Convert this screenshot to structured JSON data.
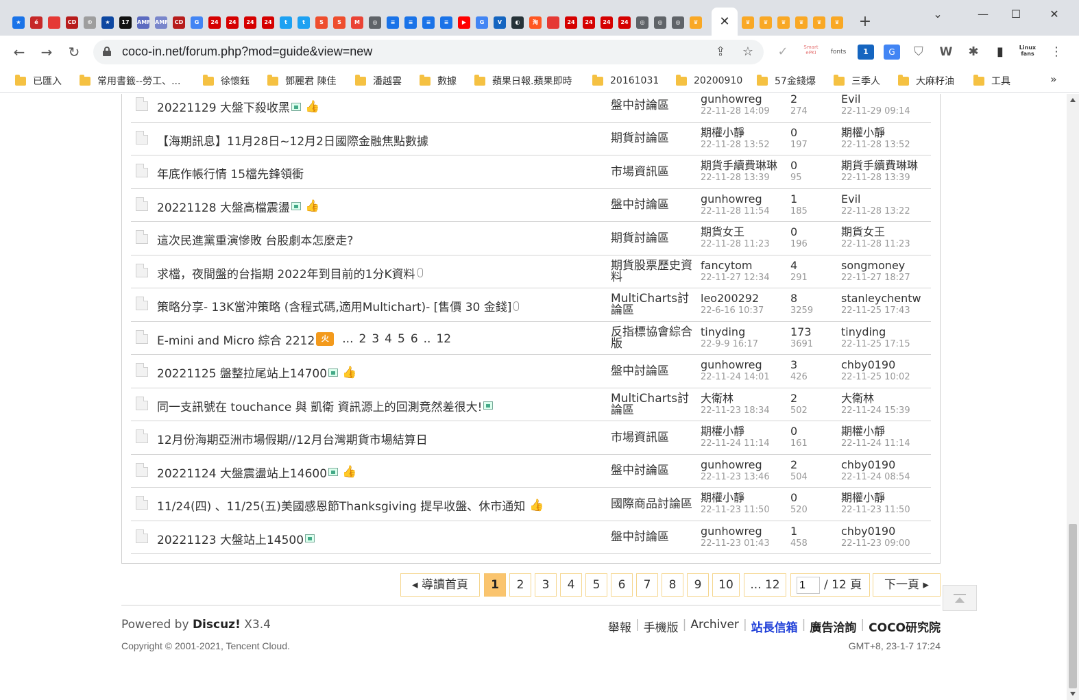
{
  "browser": {
    "url": "coco-in.net/forum.php?mod=guide&view=new",
    "tab_favicons_left": [
      {
        "icon": "star-icon",
        "color": "#1a73e8",
        "text": "★"
      },
      {
        "icon": "red-logo-icon",
        "color": "#c62828",
        "text": "é"
      },
      {
        "icon": "stripes-icon",
        "color": "#e53935",
        "text": ""
      },
      {
        "icon": "cd-icon",
        "color": "#b71c1c",
        "text": "CD"
      },
      {
        "icon": "coin-icon",
        "color": "#9e9e9e",
        "text": "©"
      },
      {
        "icon": "star-box-icon",
        "color": "#0d47a1",
        "text": "★"
      },
      {
        "icon": "17-icon",
        "color": "#111111",
        "text": "17"
      },
      {
        "icon": "amf-icon",
        "color": "#5c6bc0",
        "text": "AMF"
      },
      {
        "icon": "amf-icon",
        "color": "#7986cb",
        "text": "AMF"
      },
      {
        "icon": "cd-icon",
        "color": "#b71c1c",
        "text": "CD"
      },
      {
        "icon": "google-icon",
        "color": "#4285f4",
        "text": "G"
      },
      {
        "icon": "24-icon",
        "color": "#d50000",
        "text": "24"
      },
      {
        "icon": "24-icon",
        "color": "#d50000",
        "text": "24"
      },
      {
        "icon": "24-icon",
        "color": "#d50000",
        "text": "24"
      },
      {
        "icon": "24-icon",
        "color": "#d50000",
        "text": "24"
      },
      {
        "icon": "twitter-icon",
        "color": "#1da1f2",
        "text": "t"
      },
      {
        "icon": "twitter-icon",
        "color": "#1da1f2",
        "text": "t"
      },
      {
        "icon": "shopee-icon",
        "color": "#ee4d2d",
        "text": "S"
      },
      {
        "icon": "shopee-icon",
        "color": "#ee4d2d",
        "text": "S"
      },
      {
        "icon": "gmail-icon",
        "color": "#ea4335",
        "text": "M"
      },
      {
        "icon": "globe-icon",
        "color": "#5f6368",
        "text": "◎"
      },
      {
        "icon": "doc-icon",
        "color": "#1a73e8",
        "text": "≡"
      },
      {
        "icon": "doc-icon",
        "color": "#1a73e8",
        "text": "≡"
      },
      {
        "icon": "doc-icon",
        "color": "#1a73e8",
        "text": "≡"
      },
      {
        "icon": "doc-icon",
        "color": "#1a73e8",
        "text": "≡"
      },
      {
        "icon": "youtube-icon",
        "color": "#ff0000",
        "text": "▶"
      },
      {
        "icon": "translate-icon",
        "color": "#4285f4",
        "text": "G"
      },
      {
        "icon": "v-icon",
        "color": "#1565c0",
        "text": "V"
      },
      {
        "icon": "dark-icon",
        "color": "#263238",
        "text": "◐"
      },
      {
        "icon": "taobao-icon",
        "color": "#ff5722",
        "text": "淘"
      },
      {
        "icon": "stripes-icon",
        "color": "#e53935",
        "text": ""
      },
      {
        "icon": "24-icon",
        "color": "#d50000",
        "text": "24"
      },
      {
        "icon": "24-icon",
        "color": "#d50000",
        "text": "24"
      },
      {
        "icon": "24-icon",
        "color": "#d50000",
        "text": "24"
      },
      {
        "icon": "24-icon",
        "color": "#d50000",
        "text": "24"
      },
      {
        "icon": "globe-icon",
        "color": "#5f6368",
        "text": "◎"
      },
      {
        "icon": "globe-icon",
        "color": "#5f6368",
        "text": "◎"
      },
      {
        "icon": "globe-icon",
        "color": "#5f6368",
        "text": "◎"
      },
      {
        "icon": "trophy-icon",
        "color": "#f9a825",
        "text": "♛"
      }
    ],
    "tab_favicons_right": [
      {
        "icon": "trophy-icon",
        "color": "#f9a825",
        "text": "♛"
      },
      {
        "icon": "trophy-icon",
        "color": "#f9a825",
        "text": "♛"
      },
      {
        "icon": "trophy-icon",
        "color": "#f9a825",
        "text": "♛"
      },
      {
        "icon": "trophy-icon",
        "color": "#f9a825",
        "text": "♛"
      },
      {
        "icon": "trophy-icon",
        "color": "#f9a825",
        "text": "♛"
      },
      {
        "icon": "trophy-icon",
        "color": "#f9a825",
        "text": "♛"
      }
    ],
    "extensions": {
      "smart_label": "Smart\nePKI",
      "fonts_label": "fonts",
      "badge_count": "1",
      "linux_label": "Linux\nfans"
    },
    "bookmarks": [
      "已匯入",
      "常用書籤--勞工、...",
      "徐懷鈺",
      "鄧麗君 陳佳",
      "潘越雲",
      "數據",
      "蘋果日報.蘋果即時",
      "20161031",
      "20200910",
      "57金錢爆",
      "三季人",
      "大麻籽油",
      "工具"
    ]
  },
  "threads": [
    {
      "title": "20221129 大盤下殺收黑",
      "img": true,
      "thumb": true,
      "clip": false,
      "hot": false,
      "pages": [],
      "forum": "盤中討論區",
      "author": "gunhowreg",
      "author_date": "22-11-28 14:09",
      "replies": "2",
      "views": "274",
      "last_user": "Evil",
      "last_date": "22-11-29 09:14"
    },
    {
      "title": "【海期訊息】11月28日~12月2日國際金融焦點數據",
      "img": false,
      "thumb": false,
      "clip": false,
      "hot": false,
      "pages": [],
      "forum": "期貨討論區",
      "author": "期權小靜",
      "author_date": "22-11-28 13:52",
      "replies": "0",
      "views": "197",
      "last_user": "期權小靜",
      "last_date": "22-11-28 13:52"
    },
    {
      "title": "年底作帳行情 15檔先鋒領衝",
      "img": false,
      "thumb": false,
      "clip": false,
      "hot": false,
      "pages": [],
      "forum": "市場資訊區",
      "author": "期貨手續費琳琳",
      "author_date": "22-11-28 13:39",
      "replies": "0",
      "views": "95",
      "last_user": "期貨手續費琳琳",
      "last_date": "22-11-28 13:39"
    },
    {
      "title": "20221128 大盤高檔震盪",
      "img": true,
      "thumb": true,
      "clip": false,
      "hot": false,
      "pages": [],
      "forum": "盤中討論區",
      "author": "gunhowreg",
      "author_date": "22-11-28 11:54",
      "replies": "1",
      "views": "185",
      "last_user": "Evil",
      "last_date": "22-11-28 13:22"
    },
    {
      "title": "這次民進黨重演慘敗 台股劇本怎麼走?",
      "img": false,
      "thumb": false,
      "clip": false,
      "hot": false,
      "pages": [],
      "forum": "期貨討論區",
      "author": "期貨女王",
      "author_date": "22-11-28 11:23",
      "replies": "0",
      "views": "196",
      "last_user": "期貨女王",
      "last_date": "22-11-28 11:23"
    },
    {
      "title": "求檔，夜間盤的台指期 2022年到目前的1分K資料",
      "img": false,
      "thumb": false,
      "clip": true,
      "hot": false,
      "pages": [],
      "forum": "期貨股票歷史資料",
      "author": "fancytom",
      "author_date": "22-11-27 12:34",
      "replies": "4",
      "views": "291",
      "last_user": "songmoney",
      "last_date": "22-11-27 18:27"
    },
    {
      "title": "策略分享- 13K當沖策略 (含程式碼,適用Multichart)- [售價 30 金錢]",
      "img": false,
      "thumb": false,
      "clip": true,
      "hot": false,
      "pages": [],
      "forum": "MultiCharts討論區",
      "author": "leo200292",
      "author_date": "22-6-16 10:37",
      "replies": "8",
      "views": "3259",
      "last_user": "stanleychentw",
      "last_date": "22-11-25 17:43"
    },
    {
      "title": "E-mini and Micro 綜合 2212",
      "img": false,
      "thumb": false,
      "clip": false,
      "hot": true,
      "pages": [
        "...",
        "2",
        "3",
        "4",
        "5",
        "6",
        "..",
        "12"
      ],
      "forum": "反指標協會綜合版",
      "author": "tinyding",
      "author_date": "22-9-9 16:17",
      "replies": "173",
      "views": "3691",
      "last_user": "tinyding",
      "last_date": "22-11-25 17:15"
    },
    {
      "title": "20221125 盤整拉尾站上14700",
      "img": true,
      "thumb": true,
      "clip": false,
      "hot": false,
      "pages": [],
      "forum": "盤中討論區",
      "author": "gunhowreg",
      "author_date": "22-11-24 14:01",
      "replies": "3",
      "views": "426",
      "last_user": "chby0190",
      "last_date": "22-11-25 10:02"
    },
    {
      "title": "同一支訊號在 touchance 與 凱衛 資訊源上的回測竟然差很大!",
      "img": true,
      "thumb": false,
      "clip": false,
      "hot": false,
      "pages": [],
      "forum": "MultiCharts討論區",
      "author": "大衛林",
      "author_date": "22-11-23 18:34",
      "replies": "2",
      "views": "502",
      "last_user": "大衛林",
      "last_date": "22-11-24 15:39"
    },
    {
      "title": "12月份海期亞洲市場假期//12月台灣期貨市場結算日",
      "img": false,
      "thumb": false,
      "clip": false,
      "hot": false,
      "pages": [],
      "forum": "市場資訊區",
      "author": "期權小靜",
      "author_date": "22-11-24 11:14",
      "replies": "0",
      "views": "161",
      "last_user": "期權小靜",
      "last_date": "22-11-24 11:14"
    },
    {
      "title": "20221124 大盤震盪站上14600",
      "img": true,
      "thumb": true,
      "clip": false,
      "hot": false,
      "pages": [],
      "forum": "盤中討論區",
      "author": "gunhowreg",
      "author_date": "22-11-23 13:46",
      "replies": "2",
      "views": "504",
      "last_user": "chby0190",
      "last_date": "22-11-24 08:54"
    },
    {
      "title": "11/24(四) 、11/25(五)美國感恩節Thanksgiving 提早收盤、休市通知",
      "img": false,
      "thumb": true,
      "clip": false,
      "hot": false,
      "pages": [],
      "forum": "國際商品討論區",
      "author": "期權小靜",
      "author_date": "22-11-23 11:50",
      "replies": "0",
      "views": "520",
      "last_user": "期權小靜",
      "last_date": "22-11-23 11:50"
    },
    {
      "title": "20221123 大盤站上14500",
      "img": true,
      "thumb": false,
      "clip": false,
      "hot": false,
      "pages": [],
      "forum": "盤中討論區",
      "author": "gunhowreg",
      "author_date": "22-11-23 01:43",
      "replies": "1",
      "views": "458",
      "last_user": "chby0190",
      "last_date": "22-11-23 09:00"
    }
  ],
  "pagination": {
    "prev_label": "◂ 導讀首頁",
    "pages": [
      "1",
      "2",
      "3",
      "4",
      "5",
      "6",
      "7",
      "8",
      "9",
      "10",
      "... 12"
    ],
    "current": "1",
    "input_value": "1",
    "total_label": "/ 12 頁",
    "next_label": "下一頁 ▸"
  },
  "footer": {
    "powered_prefix": "Powered by ",
    "powered_brand": "Discuz!",
    "powered_version": " X3.4",
    "copyright": "Copyright © 2001-2021, Tencent Cloud.",
    "links": [
      "舉報",
      "手機版",
      "Archiver",
      "站長信箱",
      "廣告洽詢",
      "COCO研究院"
    ],
    "gmt": "GMT+8, 23-1-7 17:24"
  },
  "colors": {
    "accent": "#fac46e",
    "link_blue": "#1f3fd8",
    "pager_border": "#f5d68f"
  }
}
